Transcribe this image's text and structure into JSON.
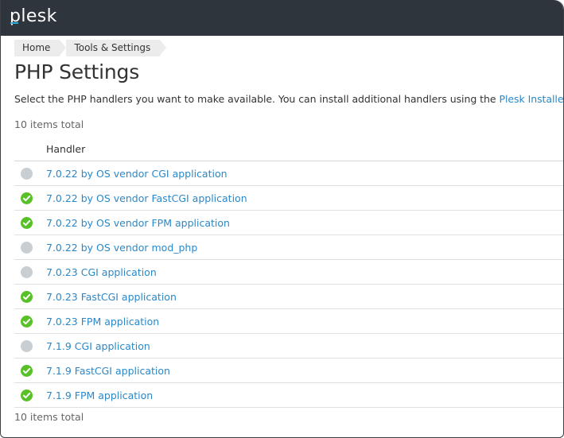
{
  "app": {
    "brand_text": "plesk",
    "brand_accent": "#28aadc",
    "header_bg": "#2f353c"
  },
  "breadcrumb": {
    "items": [
      "Home",
      "Tools & Settings"
    ]
  },
  "page": {
    "title": "PHP Settings",
    "description_prefix": "Select the PHP handlers you want to make available. You can install additional handlers using the ",
    "description_link": "Plesk Installer",
    "description_suffix": ".",
    "items_total_top": "10 items total",
    "items_total_bottom": "10 items total"
  },
  "table": {
    "columns": [
      "Handler"
    ],
    "rows": [
      {
        "name": "7.0.22 by OS vendor CGI application",
        "status": "disabled",
        "status_icon": "disabled-circle-icon"
      },
      {
        "name": "7.0.22 by OS vendor FastCGI application",
        "status": "enabled",
        "status_icon": "check-circle-icon"
      },
      {
        "name": "7.0.22 by OS vendor FPM application",
        "status": "enabled",
        "status_icon": "check-circle-icon"
      },
      {
        "name": "7.0.22 by OS vendor mod_php",
        "status": "disabled",
        "status_icon": "disabled-circle-icon"
      },
      {
        "name": "7.0.23 CGI application",
        "status": "disabled",
        "status_icon": "disabled-circle-icon"
      },
      {
        "name": "7.0.23 FastCGI application",
        "status": "enabled",
        "status_icon": "check-circle-icon"
      },
      {
        "name": "7.0.23 FPM application",
        "status": "enabled",
        "status_icon": "check-circle-icon"
      },
      {
        "name": "7.1.9 CGI application",
        "status": "disabled",
        "status_icon": "disabled-circle-icon"
      },
      {
        "name": "7.1.9 FastCGI application",
        "status": "enabled",
        "status_icon": "check-circle-icon"
      },
      {
        "name": "7.1.9 FPM application",
        "status": "enabled",
        "status_icon": "check-circle-icon"
      }
    ]
  },
  "colors": {
    "link": "#2a88c9",
    "enabled": "#58c127",
    "disabled": "#c9ced3"
  }
}
